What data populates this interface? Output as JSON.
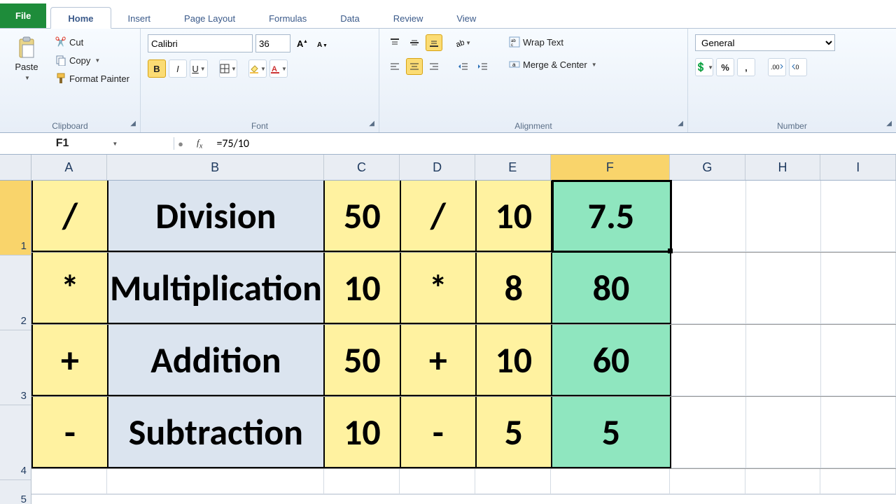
{
  "tabs": {
    "file": "File",
    "home": "Home",
    "insert": "Insert",
    "page_layout": "Page Layout",
    "formulas": "Formulas",
    "data": "Data",
    "review": "Review",
    "view": "View"
  },
  "clipboard": {
    "paste": "Paste",
    "cut": "Cut",
    "copy": "Copy",
    "format_painter": "Format Painter",
    "label": "Clipboard"
  },
  "font": {
    "name": "Calibri",
    "size": "36",
    "label": "Font"
  },
  "alignment": {
    "wrap": "Wrap Text",
    "merge": "Merge & Center",
    "label": "Alignment"
  },
  "number": {
    "format": "General",
    "label": "Number"
  },
  "namebox": "F1",
  "formula": "=75/10",
  "columns": [
    "A",
    "B",
    "C",
    "D",
    "E",
    "F",
    "G",
    "H",
    "I"
  ],
  "rows": [
    "1",
    "2",
    "3",
    "4",
    "5"
  ],
  "selected": {
    "row": 0,
    "col": "F"
  },
  "sheet": [
    {
      "A": "/",
      "B": "Division",
      "C": "50",
      "D": "/",
      "E": "10",
      "F": "7.5"
    },
    {
      "A": "*",
      "B": "Multiplication",
      "C": "10",
      "D": "*",
      "E": "8",
      "F": "80"
    },
    {
      "A": "+",
      "B": "Addition",
      "C": "50",
      "D": "+",
      "E": "10",
      "F": "60"
    },
    {
      "A": "-",
      "B": "Subtraction",
      "C": "10",
      "D": "-",
      "E": "5",
      "F": "5"
    }
  ],
  "colors": {
    "accent": "#1e8c3a",
    "yellow": "#fff2a0",
    "blue": "#dbe4ef",
    "green": "#8fe6bf"
  }
}
